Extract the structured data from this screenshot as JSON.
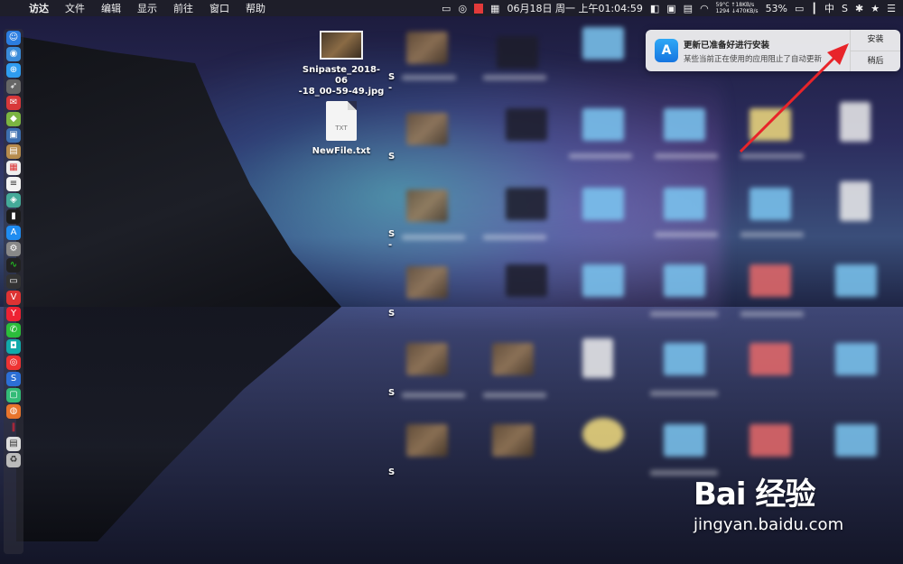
{
  "menubar": {
    "apple": "",
    "items": [
      "访达",
      "文件",
      "编辑",
      "显示",
      "前往",
      "窗口",
      "帮助"
    ],
    "status": {
      "clock": "06月18日 周一 上午01:04:59",
      "temp": "59°C",
      "net_up": "↑18KB/s",
      "cpu": "1294",
      "net_down": "↓470KB/s",
      "battery": "53%",
      "input_method": "中"
    }
  },
  "desktop": {
    "files": [
      {
        "name": "Snipaste_2018-06\n-18_00-59-49.jpg",
        "type": "image"
      },
      {
        "name": "NewFile.txt",
        "type": "text",
        "badge": "TXT"
      }
    ],
    "cut_labels": [
      "S",
      "-",
      "S",
      "S",
      "-",
      "S",
      "S",
      "S"
    ]
  },
  "notification": {
    "title": "更新已准备好进行安装",
    "text": "某些当前正在使用的应用阻止了自动更新",
    "install_label": "安装",
    "later_label": "稍后"
  },
  "watermark": {
    "brand": "Bai 经验",
    "url": "jingyan.baidu.com"
  },
  "colors": {
    "accent": "#e23a3a",
    "folder": "#7cc7f2",
    "menubar": "#1e1e28"
  }
}
